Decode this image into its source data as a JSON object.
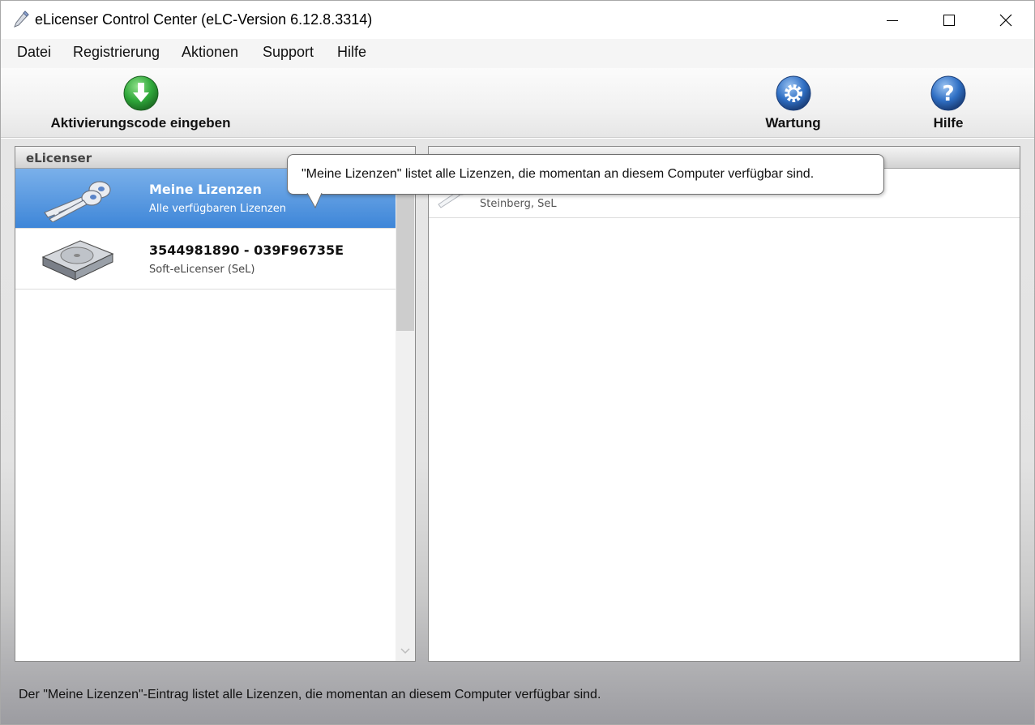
{
  "window": {
    "title": "eLicenser Control Center (eLC-Version 6.12.8.3314)"
  },
  "menu": [
    "Datei",
    "Registrierung",
    "Aktionen",
    "Support",
    "Hilfe"
  ],
  "toolbar": {
    "activate_label": "Aktivierungscode eingeben",
    "maintenance_label": "Wartung",
    "help_label": "Hilfe",
    "icons": {
      "activate": "download-arrow-icon",
      "maintenance": "gear-icon",
      "help": "question-icon"
    }
  },
  "left_panel": {
    "header": "eLicenser",
    "items": [
      {
        "title": "Meine Lizenzen",
        "subtitle": "Alle verfügbaren Lizenzen",
        "icon": "keys-icon",
        "selected": true
      },
      {
        "title": "3544981890 - 039F96735E",
        "subtitle": "Soft-eLicenser (SeL)",
        "icon": "hard-drive-icon",
        "selected": false
      }
    ]
  },
  "right_panel": {
    "header": "",
    "items": [
      {
        "subtitle": "Steinberg, SeL",
        "icon": "key-icon"
      }
    ]
  },
  "tooltip": {
    "text": "\"Meine Lizenzen\" listet alle Lizenzen, die momentan an diesem Computer verfügbar sind."
  },
  "status_bar": {
    "text": "Der \"Meine Lizenzen\"-Eintrag listet alle Lizenzen, die momentan an diesem Computer verfügbar sind."
  },
  "colors": {
    "selection": "#3e86d8",
    "activate_green": "#2fa83a",
    "tool_blue": "#2f6fc4"
  }
}
